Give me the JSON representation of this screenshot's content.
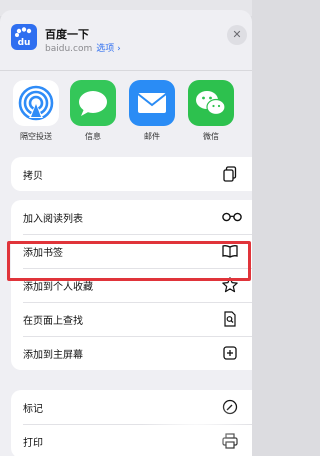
{
  "site": {
    "title": "百度一下",
    "domain": "baidu.com",
    "options_label": "选项 ›"
  },
  "share_apps": [
    {
      "label": "隔空投送",
      "icon": "airdrop-icon"
    },
    {
      "label": "信息",
      "icon": "messages-icon"
    },
    {
      "label": "邮件",
      "icon": "mail-icon"
    },
    {
      "label": "微信",
      "icon": "wechat-icon"
    }
  ],
  "actions": {
    "copy": {
      "label": "拷贝",
      "icon": "copy-icon"
    },
    "reading_list": {
      "label": "加入阅读列表",
      "icon": "glasses-icon"
    },
    "bookmark": {
      "label": "添加书签",
      "icon": "book-icon"
    },
    "favorites": {
      "label": "添加到个人收藏",
      "icon": "star-icon"
    },
    "find_on_page": {
      "label": "在页面上查找",
      "icon": "find-doc-icon"
    },
    "home_screen": {
      "label": "添加到主屏幕",
      "icon": "plus-square-icon"
    },
    "markup": {
      "label": "标记",
      "icon": "markup-icon"
    },
    "print": {
      "label": "打印",
      "icon": "printer-icon"
    }
  },
  "colors": {
    "highlight": "#e0343a",
    "accent": "#2f6ff0"
  }
}
